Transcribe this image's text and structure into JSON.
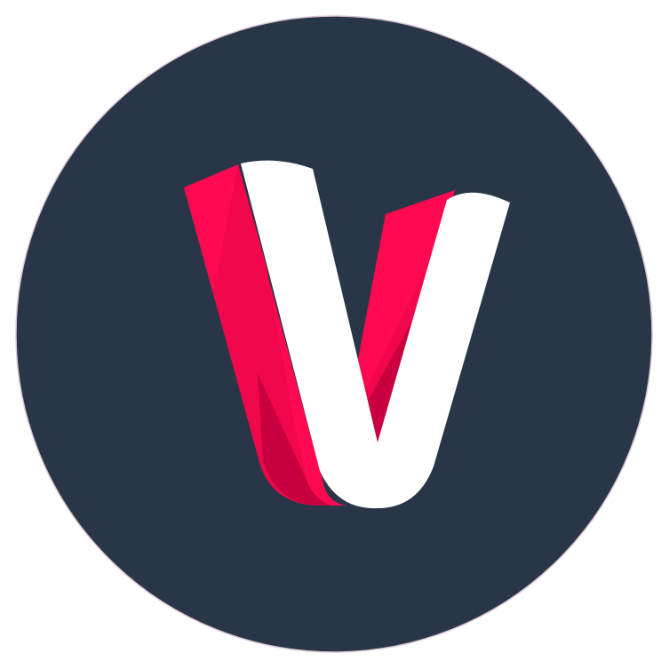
{
  "logo": {
    "name": "v-letter-logo",
    "shape": "circle",
    "colors": {
      "background_circle": "#283647",
      "circle_rim": "#d9c2cf",
      "ribbon_bright": "#ff0a50",
      "ribbon_mid": "#f2074a",
      "ribbon_dark": "#c90040",
      "face": "#ffffff"
    }
  }
}
